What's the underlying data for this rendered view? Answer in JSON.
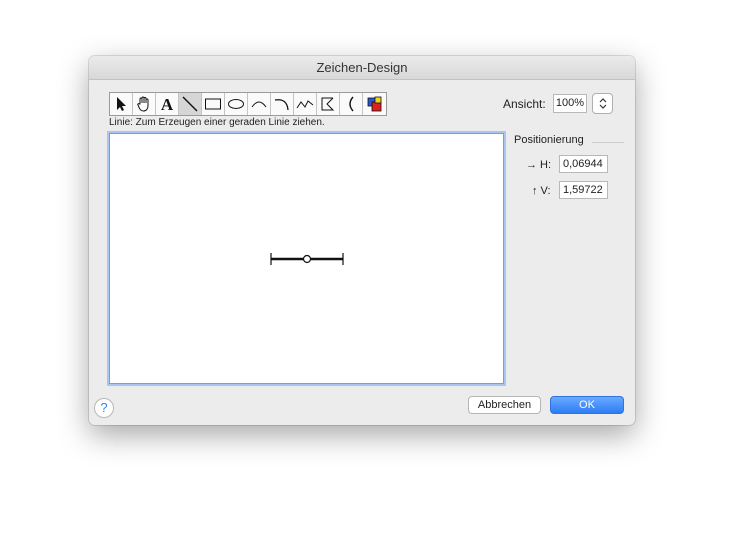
{
  "dialog": {
    "title": "Zeichen-Design",
    "hint": "Linie: Zum Erzeugen einer geraden Linie ziehen.",
    "tools": [
      {
        "name": "arrow-select-icon"
      },
      {
        "name": "hand-icon"
      },
      {
        "name": "text-tool-icon"
      },
      {
        "name": "line-tool-icon",
        "active": true
      },
      {
        "name": "rectangle-tool-icon"
      },
      {
        "name": "ellipse-tool-icon"
      },
      {
        "name": "arc-tool-icon"
      },
      {
        "name": "curve-tool-icon"
      },
      {
        "name": "freeform-tool-icon"
      },
      {
        "name": "polygon-tool-icon"
      },
      {
        "name": "bracket-tool-icon"
      },
      {
        "name": "color-palette-icon"
      }
    ],
    "view_label": "Ansicht:",
    "zoom_value": "100%",
    "positioning_title": "Positionierung",
    "h_label": "→ H:",
    "h_value": "0,06944",
    "v_label": "↑ V:",
    "v_value": "1,59722",
    "cancel_label": "Abbrechen",
    "ok_label": "OK",
    "help_label": "?",
    "accent_color": "#2d7df5"
  }
}
